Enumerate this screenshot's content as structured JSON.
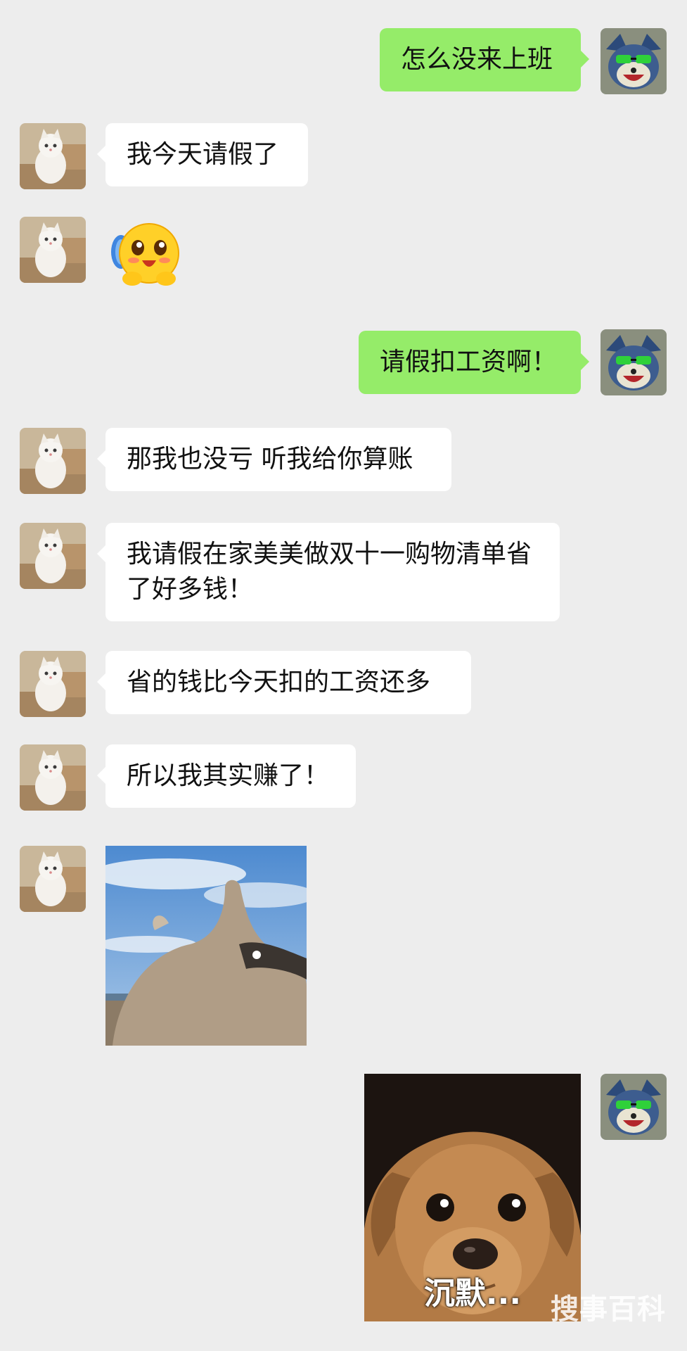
{
  "messages": [
    {
      "side": "right",
      "text": "怎么没来上班"
    },
    {
      "side": "left",
      "text": "我今天请假了"
    },
    {
      "side": "left",
      "type": "emoji",
      "icon": "shy-smile-emoji"
    },
    {
      "side": "right",
      "text": "请假扣工资啊！"
    },
    {
      "side": "left",
      "text": "那我也没亏 听我给你算账"
    },
    {
      "side": "left",
      "text": "我请假在家美美做双十一购物清单省了好多钱！"
    },
    {
      "side": "left",
      "text": "省的钱比今天扣的工资还多"
    },
    {
      "side": "left",
      "text": "所以我其实赚了！"
    },
    {
      "side": "left",
      "type": "sticker",
      "icon": "alpaca-sticker"
    },
    {
      "side": "right",
      "type": "sticker",
      "icon": "dog-sticker",
      "caption": "沉默..."
    }
  ],
  "watermark": "搜事百科",
  "colors": {
    "background": "#ededed",
    "incoming_bubble": "#ffffff",
    "outgoing_bubble": "#95ec69"
  }
}
